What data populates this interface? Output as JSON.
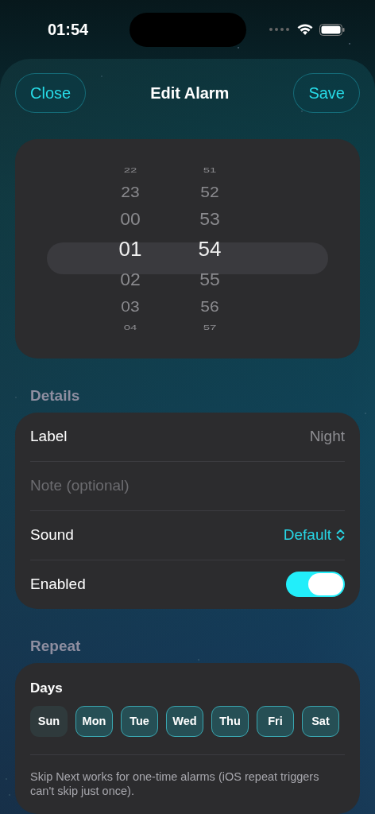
{
  "status_bar": {
    "time": "01:54"
  },
  "header": {
    "close": "Close",
    "title": "Edit Alarm",
    "save": "Save"
  },
  "picker": {
    "hours": [
      {
        "value": "22",
        "selected": false
      },
      {
        "value": "23",
        "selected": false
      },
      {
        "value": "00",
        "selected": false
      },
      {
        "value": "01",
        "selected": true
      },
      {
        "value": "02",
        "selected": false
      },
      {
        "value": "03",
        "selected": false
      },
      {
        "value": "04",
        "selected": false
      }
    ],
    "minutes": [
      {
        "value": "51",
        "selected": false
      },
      {
        "value": "52",
        "selected": false
      },
      {
        "value": "53",
        "selected": false
      },
      {
        "value": "54",
        "selected": true
      },
      {
        "value": "55",
        "selected": false
      },
      {
        "value": "56",
        "selected": false
      },
      {
        "value": "57",
        "selected": false
      }
    ]
  },
  "details": {
    "heading": "Details",
    "rows": [
      {
        "kind": "text",
        "label": "Label",
        "value": "Night"
      },
      {
        "kind": "field",
        "placeholder": "Note (optional)"
      },
      {
        "kind": "menu",
        "label": "Sound",
        "value": "Default"
      },
      {
        "kind": "toggle",
        "label": "Enabled",
        "on": true
      }
    ]
  },
  "repeat": {
    "heading": "Repeat",
    "days_label": "Days",
    "days": [
      {
        "label": "Sun",
        "selected": false
      },
      {
        "label": "Mon",
        "selected": true
      },
      {
        "label": "Tue",
        "selected": true
      },
      {
        "label": "Wed",
        "selected": true
      },
      {
        "label": "Thu",
        "selected": true
      },
      {
        "label": "Fri",
        "selected": true
      },
      {
        "label": "Sat",
        "selected": true
      }
    ],
    "note": "Skip Next works for one-time alarms (iOS repeat triggers can't skip just once)."
  }
}
